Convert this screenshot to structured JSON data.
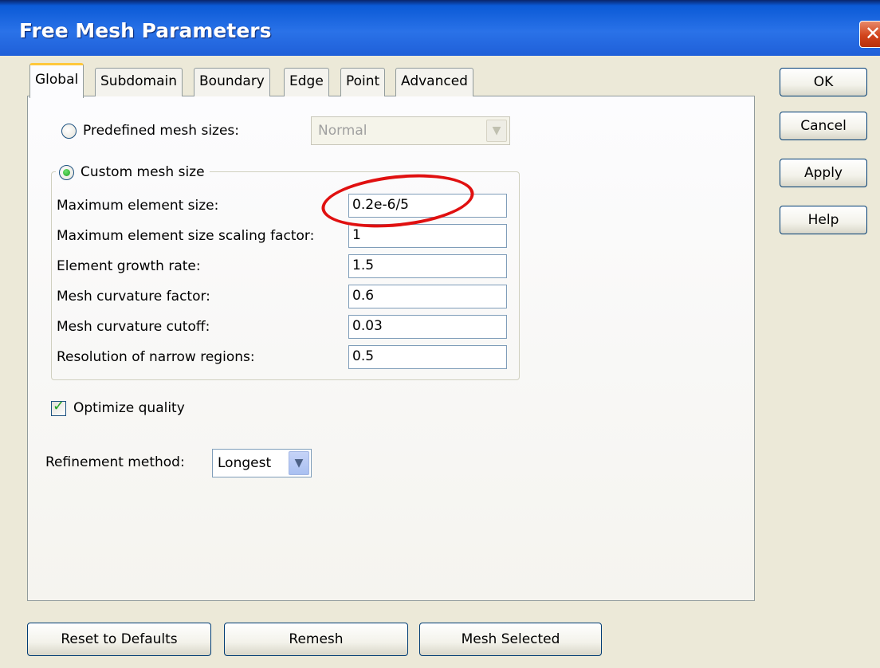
{
  "window": {
    "title": "Free Mesh Parameters",
    "close_glyph": "✕"
  },
  "tabs": [
    {
      "label": "Global",
      "active": true
    },
    {
      "label": "Subdomain",
      "active": false
    },
    {
      "label": "Boundary",
      "active": false
    },
    {
      "label": "Edge",
      "active": false
    },
    {
      "label": "Point",
      "active": false
    },
    {
      "label": "Advanced",
      "active": false
    }
  ],
  "predefined": {
    "label": "Predefined mesh sizes:",
    "selected": false,
    "value": "Normal",
    "enabled": false
  },
  "custom": {
    "label": "Custom mesh size",
    "selected": true,
    "fields": [
      {
        "label": "Maximum element size:",
        "value": "0.2e-6/5"
      },
      {
        "label": "Maximum element size scaling factor:",
        "value": "1"
      },
      {
        "label": "Element growth rate:",
        "value": "1.5"
      },
      {
        "label": "Mesh curvature factor:",
        "value": "0.6"
      },
      {
        "label": "Mesh curvature cutoff:",
        "value": "0.03"
      },
      {
        "label": "Resolution of narrow regions:",
        "value": "0.5"
      }
    ]
  },
  "optimize": {
    "label": "Optimize quality",
    "checked": true
  },
  "refinement": {
    "label": "Refinement method:",
    "value": "Longest"
  },
  "side_buttons": {
    "ok": "OK",
    "cancel": "Cancel",
    "apply": "Apply",
    "help": "Help"
  },
  "bottom_buttons": {
    "reset": "Reset to Defaults",
    "remesh": "Remesh",
    "mesh_selected": "Mesh Selected"
  },
  "colors": {
    "titlebar": "#0b5ad6",
    "dialog_bg": "#ece9d8",
    "active_tab_accent": "#ffc83c",
    "annotation": "#e01010",
    "radio_check": "#21a121"
  },
  "icons": {
    "dropdown": "chevron-down-icon",
    "close": "close-icon",
    "check": "checkmark-icon"
  }
}
